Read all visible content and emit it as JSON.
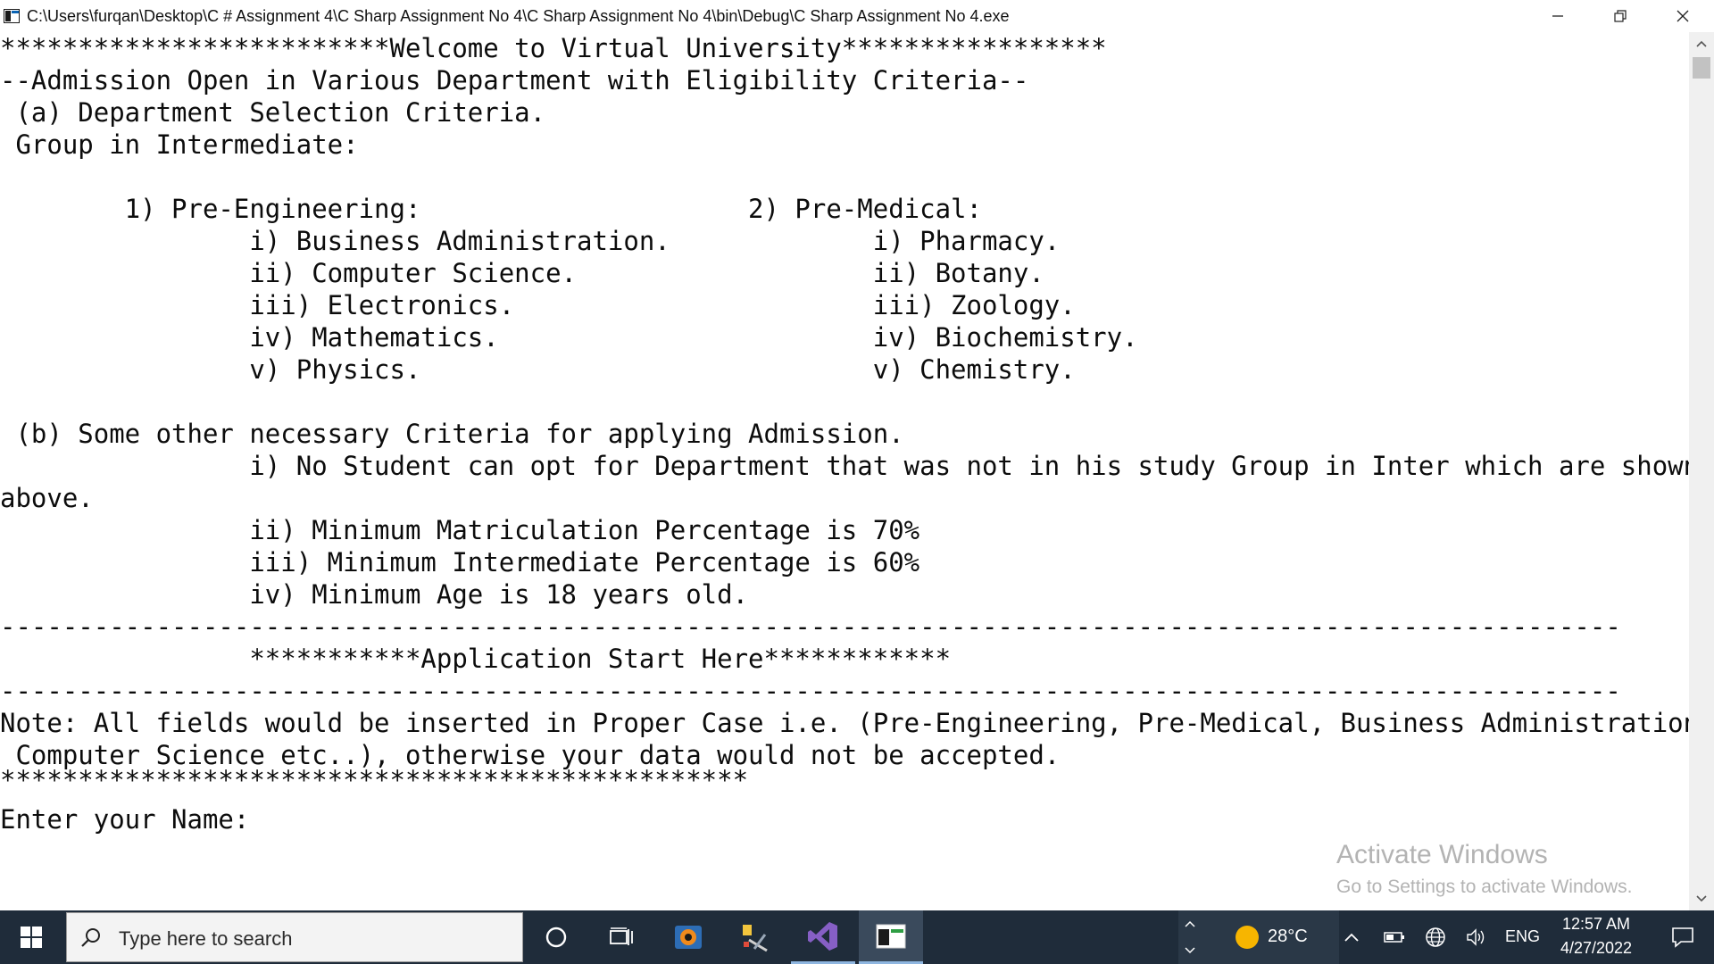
{
  "window": {
    "title": "C:\\Users\\furqan\\Desktop\\C # Assignment 4\\C Sharp Assignment No 4\\C Sharp Assignment No 4\\bin\\Debug\\C Sharp Assignment No 4.exe",
    "app_icon": "console-app-icon",
    "controls": {
      "minimize": "minimize-icon",
      "maximize": "restore-icon",
      "close": "close-icon"
    }
  },
  "console": {
    "lines": [
      "*************************Welcome to Virtual University*****************",
      "--Admission Open in Various Department with Eligibility Criteria--",
      " (a) Department Selection Criteria.",
      " Group in Intermediate:",
      "",
      "        1) Pre-Engineering:                     2) Pre-Medical:",
      "                i) Business Administration.             i) Pharmacy.",
      "                ii) Computer Science.                   ii) Botany.",
      "                iii) Electronics.                       iii) Zoology.",
      "                iv) Mathematics.                        iv) Biochemistry.",
      "                v) Physics.                             v) Chemistry.",
      "",
      " (b) Some other necessary Criteria for applying Admission.",
      "                i) No Student can opt for Department that was not in his study Group in Inter which are shown",
      "above.",
      "                ii) Minimum Matriculation Percentage is 70%",
      "                iii) Minimum Intermediate Percentage is 60%",
      "                iv) Minimum Age is 18 years old.",
      "--------------------------------------------------------------------------------------------------------",
      "                ***********Application Start Here************",
      "--------------------------------------------------------------------------------------------------------",
      "Note: All fields would be inserted in Proper Case i.e. (Pre-Engineering, Pre-Medical, Business Administration,",
      " Computer Science etc..), otherwise your data would not be accepted.",
      "************************************************",
      "Enter your Name:"
    ]
  },
  "watermark": {
    "title": "Activate Windows",
    "subtitle": "Go to Settings to activate Windows."
  },
  "taskbar": {
    "search_placeholder": "Type here to search",
    "weather_temp": "28°C",
    "language": "ENG",
    "time": "12:57 AM",
    "date": "4/27/2022",
    "colors": {
      "background": "#1f2c3a",
      "weather_sun": "#f7b500",
      "vs_purple": "#865fc5"
    }
  }
}
